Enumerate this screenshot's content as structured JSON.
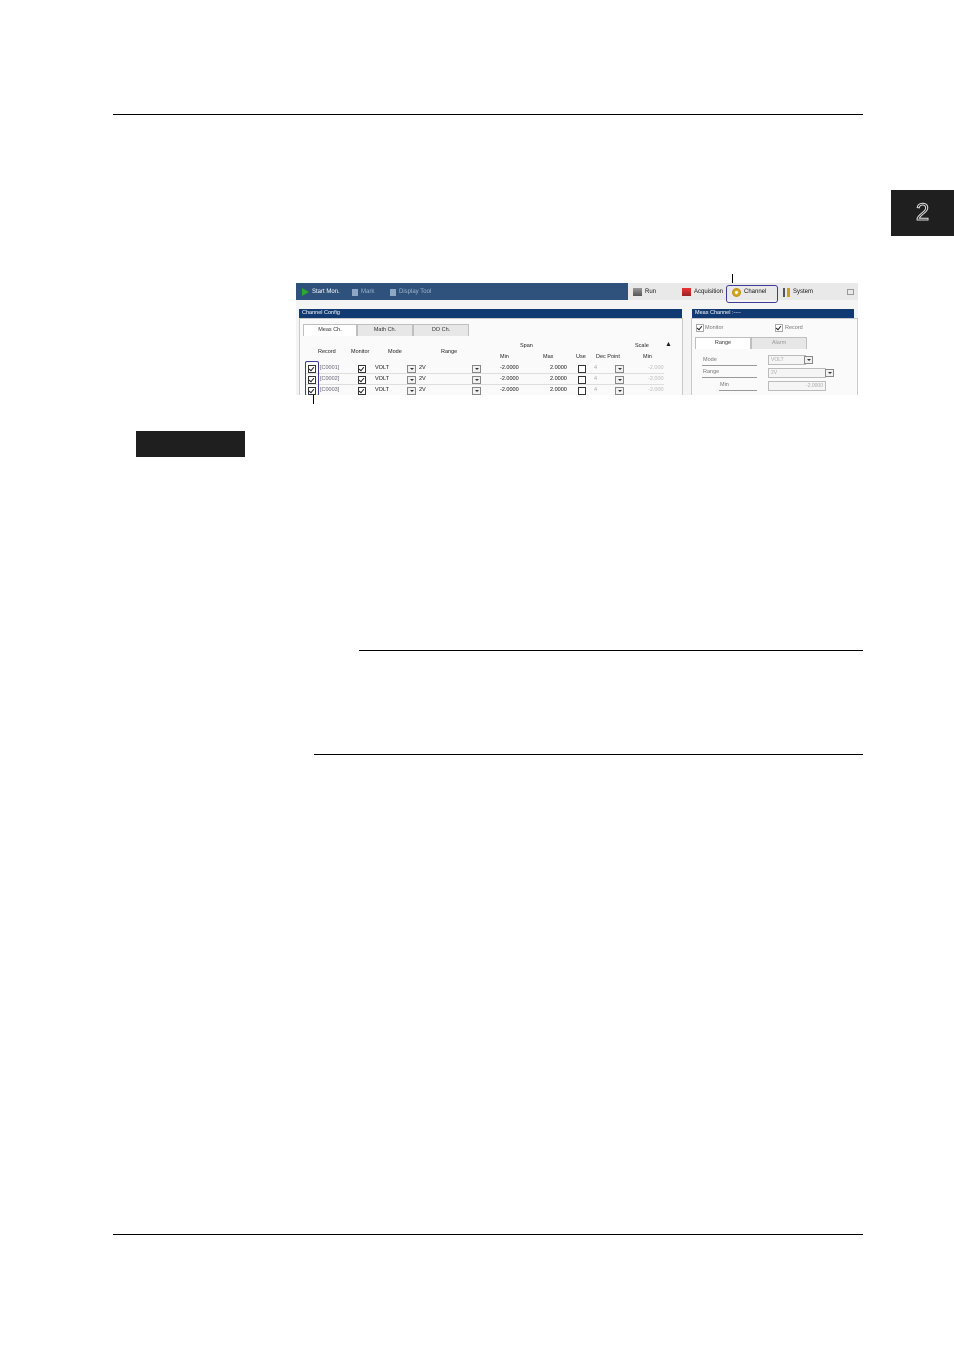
{
  "chapter": {
    "number": "2"
  },
  "toolbar": {
    "start_mon": "Start Mon.",
    "mark": "Mark",
    "display_tool": "Display Tool",
    "run": "Run",
    "acquisition": "Acquisition",
    "channel": "Channel",
    "system": "System"
  },
  "channel_config": {
    "title": "Channel Config",
    "tabs": [
      "Meas Ch.",
      "Math Ch.",
      "DO Ch."
    ],
    "headers": {
      "record": "Record",
      "monitor": "Monitor",
      "mode": "Mode",
      "range": "Range",
      "span": "Span",
      "span_min": "Min",
      "span_max": "Max",
      "scale": "Scale",
      "use": "Use",
      "dec_point": "Dec Point",
      "scale_min": "Min"
    },
    "rows": [
      {
        "record": "[C0001]",
        "mode": "VOLT",
        "range": "2V",
        "min": "-2.0000",
        "max": "2.0000",
        "dec": "4",
        "scale_min": "-2.000"
      },
      {
        "record": "[C0002]",
        "mode": "VOLT",
        "range": "2V",
        "min": "-2.0000",
        "max": "2.0000",
        "dec": "4",
        "scale_min": "-2.000"
      },
      {
        "record": "[C0003]",
        "mode": "VOLT",
        "range": "2V",
        "min": "-2.0000",
        "max": "2.0000",
        "dec": "4",
        "scale_min": "-2.000"
      }
    ]
  },
  "meas_channel": {
    "title": "Meas Channel :----",
    "monitor": "Monitor",
    "record": "Record",
    "tabs": [
      "Range",
      "Alarm"
    ],
    "mode_label": "Mode",
    "mode_value": "VOLT",
    "range_label": "Range",
    "range_value": "2V",
    "min_label": "Min",
    "min_value": "-2.0000"
  }
}
